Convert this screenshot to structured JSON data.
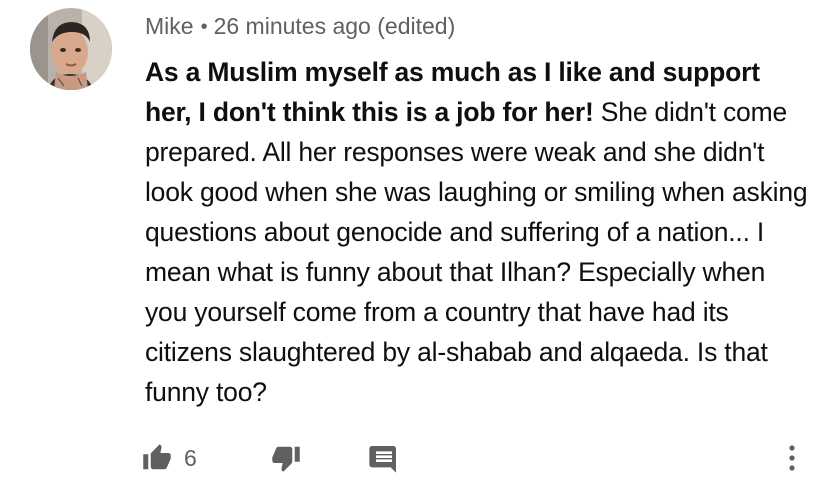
{
  "comment": {
    "author": "Mike",
    "separator": "•",
    "timestamp": "26 minutes ago (edited)",
    "body_bold": "As a Muslim myself as much as I like and support her, I don't think this is a job for her!",
    "body_regular": " She didn't come prepared. All her responses were weak and she didn't look good when she was laughing or smiling when asking questions about genocide and suffering of a nation... I mean what is funny about that Ilhan? Especially when you yourself come from a country that have had its citizens slaughtered by al-shabab and alqaeda. Is that funny too?"
  },
  "actions": {
    "like_count": "6",
    "like_icon": "thumbs-up-icon",
    "dislike_icon": "thumbs-down-icon",
    "reply_icon": "reply-comment-icon",
    "more_icon": "more-vertical-icon"
  },
  "colors": {
    "text_primary": "#0f0f0f",
    "text_secondary": "#606060",
    "icon": "#606060",
    "background": "#ffffff"
  }
}
